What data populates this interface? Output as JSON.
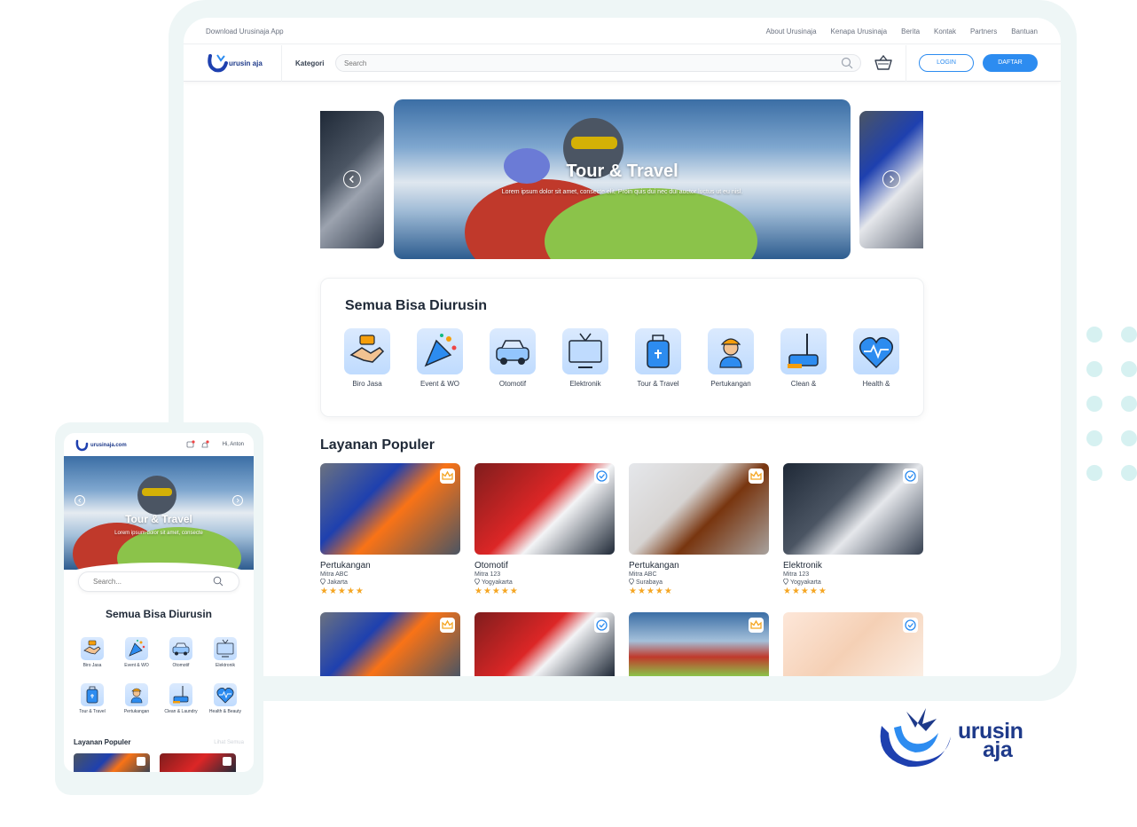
{
  "topbar": {
    "download": "Download Urusinaja App",
    "links": [
      "About Urusinaja",
      "Kenapa Urusinaja",
      "Berita",
      "Kontak",
      "Partners",
      "Bantuan"
    ]
  },
  "navbar": {
    "logo_text": "urusin aja",
    "kategori": "Kategori",
    "search_placeholder": "Search",
    "login": "LOGIN",
    "daftar": "DAFTAR"
  },
  "hero": {
    "title": "Tour & Travel",
    "subtitle": "Lorem ipsum dolor sit amet, consecte elit. Proin quis dui nec dui auctor luctus ut eu nisl."
  },
  "categories": {
    "title": "Semua Bisa Diurusin",
    "items": [
      {
        "label": "Biro Jasa",
        "icon": "handshake-icon"
      },
      {
        "label": "Event & WO",
        "icon": "party-popper-icon"
      },
      {
        "label": "Otomotif",
        "icon": "car-icon"
      },
      {
        "label": "Elektronik",
        "icon": "tv-icon"
      },
      {
        "label": "Tour & Travel",
        "icon": "luggage-icon"
      },
      {
        "label": "Pertukangan",
        "icon": "worker-icon"
      },
      {
        "label": "Clean &",
        "icon": "vacuum-icon"
      },
      {
        "label": "Health &",
        "icon": "heart-pulse-icon"
      }
    ]
  },
  "popular": {
    "title": "Layanan Populer",
    "items": [
      {
        "category": "Pertukangan",
        "mitra": "Mitra ABC",
        "location": "Jakarta",
        "rating": 5,
        "badge": "crown-icon"
      },
      {
        "category": "Otomotif",
        "mitra": "Mitra 123",
        "location": "Yogyakarta",
        "rating": 5,
        "badge": "verified-icon"
      },
      {
        "category": "Pertukangan",
        "mitra": "Mitra ABC",
        "location": "Surabaya",
        "rating": 5,
        "badge": "crown-icon"
      },
      {
        "category": "Elektronik",
        "mitra": "Mitra 123",
        "location": "Yogyakarta",
        "rating": 5,
        "badge": "verified-icon"
      }
    ],
    "stars": "★★★★★"
  },
  "mobile": {
    "logo_text": "urusinaja.com",
    "user": "Hi, Anton",
    "hero_title": "Tour & Travel",
    "hero_sub": "Lorem ipsum dolor sit amet, consecte",
    "search_placeholder": "Search...",
    "cat_title": "Semua Bisa Diurusin",
    "cats": [
      "Biro Jasa",
      "Event & WO",
      "Otomotif",
      "Elektronik",
      "Tour & Travel",
      "Pertukangan",
      "Clean & Laundry",
      "Health & Beauty"
    ],
    "pop_title": "Layanan Populer",
    "pop_all": "Lihat Semua"
  },
  "brand": {
    "line1": "urusin",
    "line2": "aja"
  },
  "colors": {
    "primary": "#2d8cf0",
    "navy": "#1e3a8a",
    "star": "#f5a623",
    "frame": "#eef6f6"
  }
}
